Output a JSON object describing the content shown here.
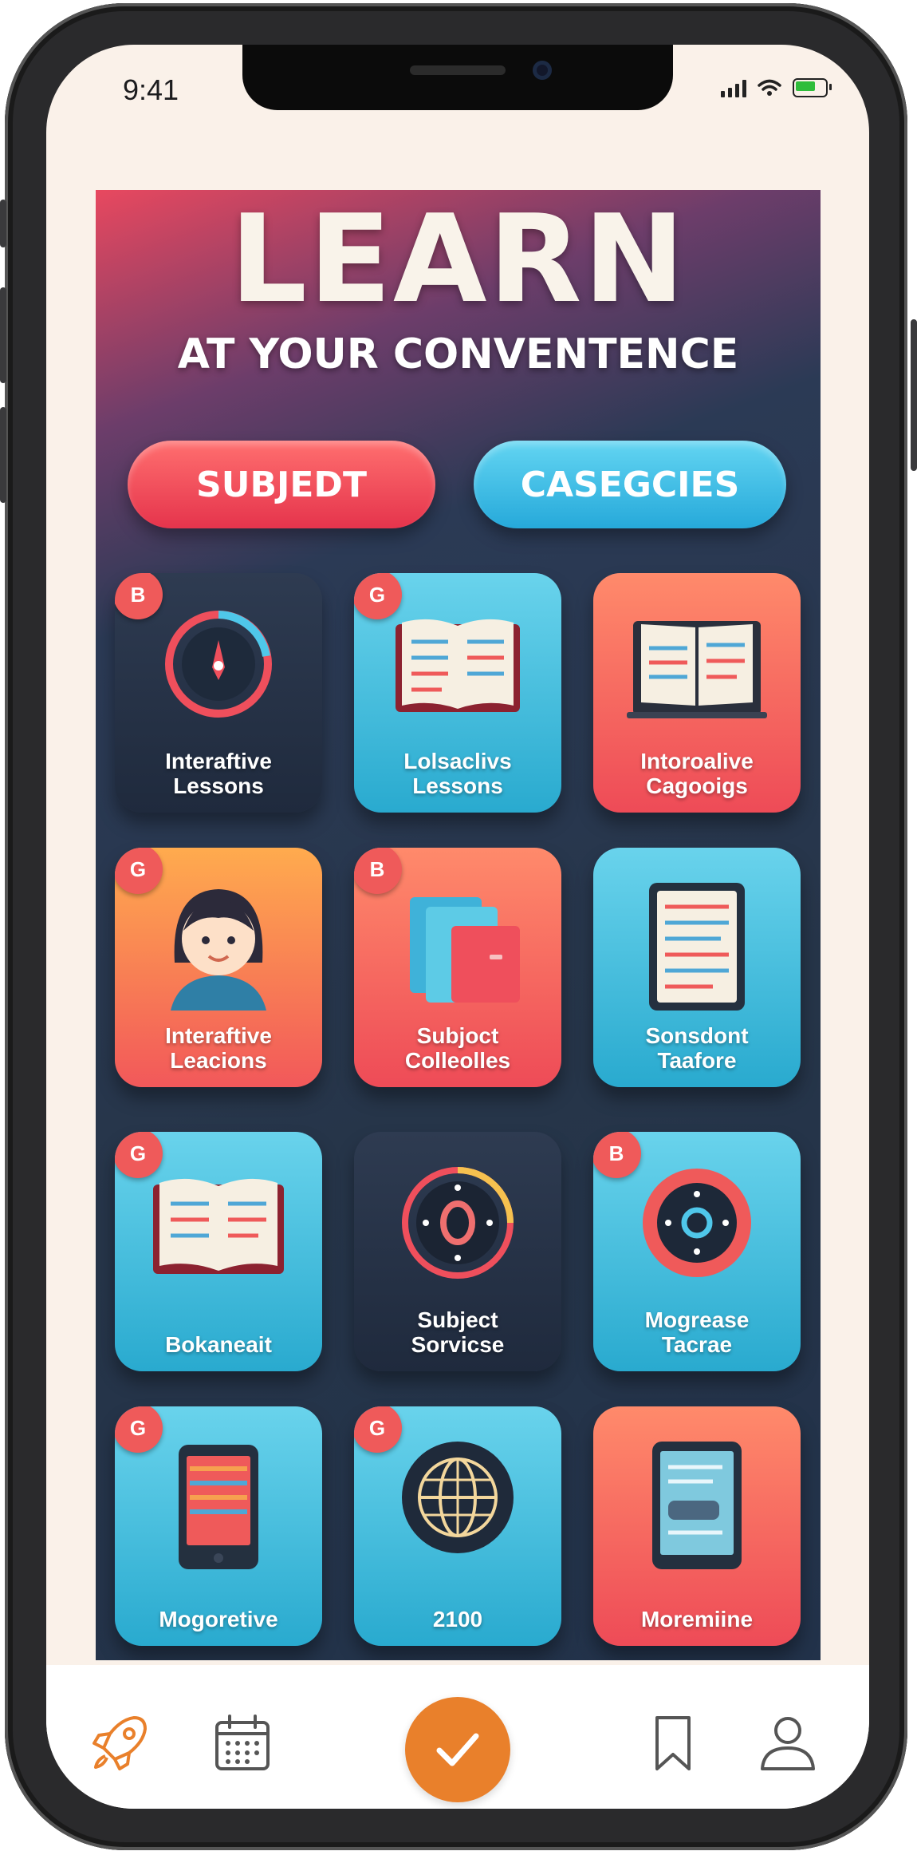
{
  "status_bar": {
    "time": "9:41"
  },
  "poster": {
    "headline": "LEARN",
    "subheadline": "AT YOUR CONVENTENCE",
    "buttons": [
      {
        "label": "SUBJEDT",
        "color": "#e5344c"
      },
      {
        "label": "CASEGCIES",
        "color": "#26a9da"
      }
    ],
    "tiles": [
      {
        "label": "Interaftive\nLessons",
        "badge": "B",
        "icon": "compass-icon",
        "style": "dark"
      },
      {
        "label": "Lolsaclivs\nLessons",
        "badge": "G",
        "icon": "open-book-icon",
        "style": "cyan"
      },
      {
        "label": "Intoroalive\nCagooigs",
        "badge": "",
        "icon": "open-book-icon",
        "style": "coral"
      },
      {
        "label": "Interaftive\nLeacions",
        "badge": "G",
        "icon": "student-avatar-icon",
        "style": "orange"
      },
      {
        "label": "Subjoct\nColleolles",
        "badge": "B",
        "icon": "stacked-books-icon",
        "style": "coral"
      },
      {
        "label": "Sonsdont\nTaafore",
        "badge": "",
        "icon": "document-icon",
        "style": "cyan"
      },
      {
        "label": "Bokaneait",
        "badge": "G",
        "icon": "open-book-icon",
        "style": "cyan"
      },
      {
        "label": "Subject\nSorvicse",
        "badge": "",
        "icon": "target-dial-icon",
        "style": "dark"
      },
      {
        "label": "Mogrease\nTacrae",
        "badge": "B",
        "icon": "progress-dial-icon",
        "style": "cyan"
      },
      {
        "label": "Mogoretive",
        "badge": "G",
        "icon": "tablet-icon",
        "style": "cyan"
      },
      {
        "label": "2100",
        "badge": "G",
        "icon": "globe-icon",
        "style": "cyan"
      },
      {
        "label": "Moremiine",
        "badge": "",
        "icon": "tablet-icon",
        "style": "coral"
      }
    ]
  },
  "tab_bar": {
    "accent": "#e9802b",
    "items": [
      {
        "icon": "rocket-icon",
        "active": true
      },
      {
        "icon": "calendar-icon",
        "active": false
      },
      {
        "icon": "checkmark-icon",
        "primary": true
      },
      {
        "icon": "bookmark-icon",
        "active": false
      },
      {
        "icon": "profile-icon",
        "active": false
      }
    ]
  }
}
